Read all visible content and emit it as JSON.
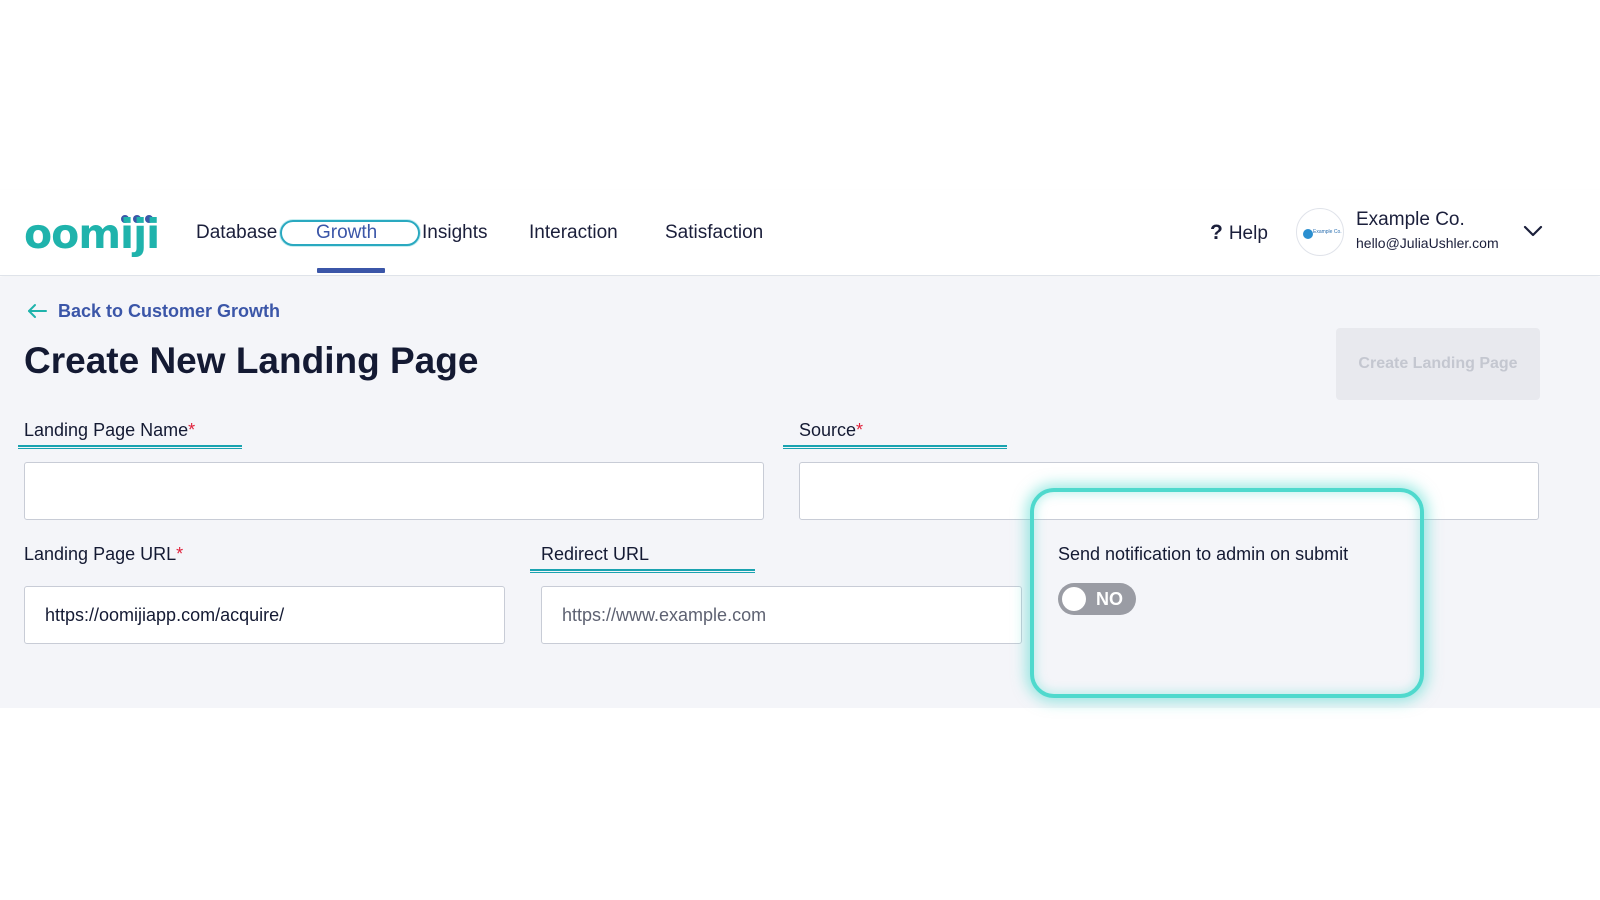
{
  "brand": {
    "logo_text": "oomiji"
  },
  "nav": {
    "items": [
      {
        "label": "Database"
      },
      {
        "label": "Growth"
      },
      {
        "label": "Insights"
      },
      {
        "label": "Interaction"
      },
      {
        "label": "Satisfaction"
      }
    ],
    "active": "Growth"
  },
  "header": {
    "help_label": "Help",
    "avatar_text": "Example Co.",
    "account_name": "Example Co.",
    "account_email": "hello@JuliaUshler.com"
  },
  "page": {
    "back_link": "Back to Customer Growth",
    "title_prefix": "Create New",
    "title_bold": "Landing Page",
    "create_button": "Create Landing Page"
  },
  "form": {
    "name_label": "Landing Page Name",
    "name_value": "",
    "source_label": "Source",
    "source_value": "",
    "url_label": "Landing Page URL",
    "url_value": "https://oomijiapp.com/acquire/",
    "redirect_label": "Redirect URL",
    "redirect_placeholder": "https://www.example.com",
    "required_mark": "*",
    "notify_label": "Send notification to admin on submit",
    "notify_state": "NO"
  },
  "colors": {
    "brand_teal": "#1fb3ac",
    "brand_navy": "#3b56a8",
    "highlight": "#4fd9cd",
    "required": "#e0203a"
  }
}
